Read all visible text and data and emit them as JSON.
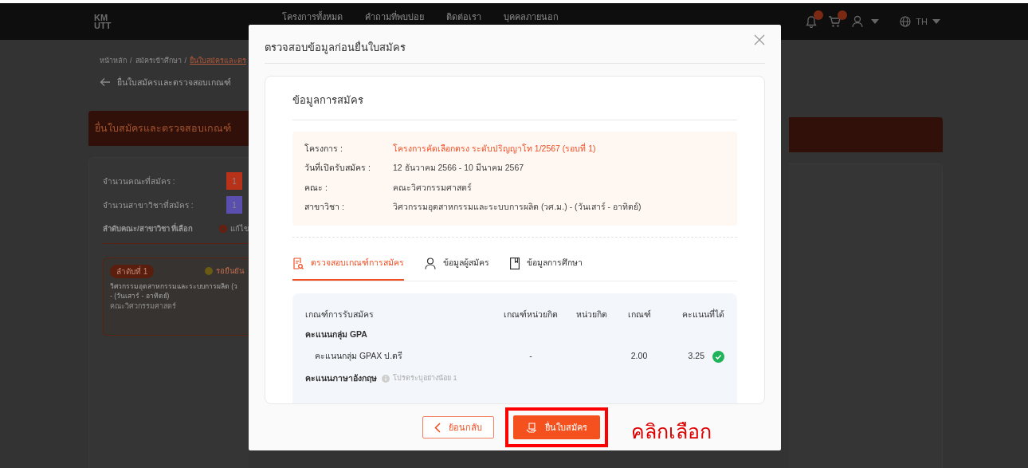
{
  "navbar": {
    "logo": {
      "line_1": "KM",
      "line_2": "UTT"
    },
    "links": [
      "โครงการทั้งหมด",
      "คำถามที่พบบ่อย",
      "ติดต่อเรา",
      "บุคคลภายนอก"
    ],
    "language": "TH"
  },
  "page": {
    "breadcrumb_separator": "/",
    "breadcrumb": [
      {
        "label": "หน้าหลัก",
        "current": false
      },
      {
        "label": "สมัครเข้าศึกษา",
        "current": false
      },
      {
        "label": "ยื่นใบสมัครและตร",
        "current": true
      }
    ],
    "title": "ยื่นใบสมัครและตรวจสอบเกณฑ์",
    "banner": "ยื่นใบสมัครและตรวจสอบเกณฑ์",
    "counts": [
      {
        "label": "จำนวนคณะที่สมัคร :",
        "value": "1",
        "color": "#b8321a"
      },
      {
        "label": "จำนวนสาขาวิชาที่สมัคร :",
        "value": "1",
        "color": "#5a4fae"
      }
    ],
    "choices_heading": "ลำดับคณะ/สาขาวิชา ที่เลือก",
    "edit_link": "แก้ไข",
    "choice": {
      "rank": "ลำดับที่ 1",
      "status": "รอยืนยัน",
      "major": "วิศวกรรมอุตสาหกรรมและระบบการผลิต (ว",
      "schedule": "- (วันเสาร์ - อาทิตย์)",
      "faculty": "คณะวิศวกรรมศาสตร์"
    }
  },
  "modal": {
    "title": "ตรวจสอบข้อมูลก่อนยื่นใบสมัคร",
    "section_title": "ข้อมูลการสมัคร",
    "info": [
      {
        "label": "โครงการ :",
        "value": "โครงการคัดเลือกตรง ระดับปริญญาโท 1/2567 (รอบที่ 1)",
        "highlight": true
      },
      {
        "label": "วันที่เปิดรับสมัคร :",
        "value": "12 ธันวาคม 2566 - 10 มีนาคม 2567",
        "highlight": false
      },
      {
        "label": "คณะ :",
        "value": "คณะวิศวกรรมศาสตร์",
        "highlight": false
      },
      {
        "label": "สาขาวิชา :",
        "value": "วิศวกรรมอุตสาหกรรมและระบบการผลิต (วศ.ม.) - (วันเสาร์ - อาทิตย์)",
        "highlight": false
      }
    ],
    "tabs": [
      {
        "label": "ตรวจสอบเกณฑ์การสมัคร",
        "selected": true
      },
      {
        "label": "ข้อมูลผู้สมัคร",
        "selected": false
      },
      {
        "label": "ข้อมูลการศึกษา",
        "selected": false
      }
    ],
    "criteria": {
      "columns": [
        "เกณฑ์การรับสมัคร",
        "เกณฑ์หน่วยกิต",
        "หน่วยกิต",
        "เกณฑ์",
        "คะแนนที่ได้"
      ],
      "groups": [
        {
          "name": "คะแนนกลุ่ม GPA",
          "rows": [
            {
              "name": "คะแนนกลุ่ม GPAX ป.ตรี",
              "credit_criteria": "-",
              "criteria": "2.00",
              "score": "3.25",
              "passed": true
            }
          ]
        },
        {
          "name": "คะแนนภาษาอังกฤษ",
          "note": "โปรดระบุอย่างน้อย 1"
        }
      ]
    },
    "buttons": {
      "back": "ย้อนกลับ",
      "submit": "ยื่นใบสมัคร"
    }
  },
  "annotation": {
    "text": "คลิกเลือก"
  }
}
